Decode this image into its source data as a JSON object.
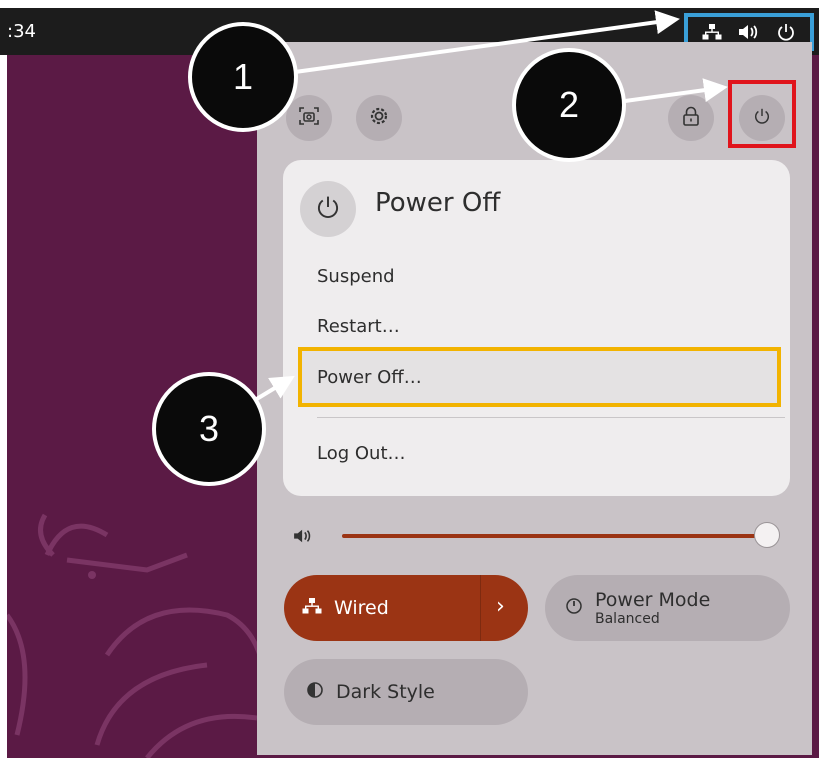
{
  "topbar": {
    "clock": ":34",
    "tray_icons": [
      "network-wired-icon",
      "volume-icon",
      "power-icon"
    ]
  },
  "quick_settings": {
    "top_buttons": [
      "screenshot-icon",
      "settings-icon",
      "lock-icon",
      "power-icon"
    ],
    "power_menu": {
      "title": "Power Off",
      "items": [
        "Suspend",
        "Restart…",
        "Power Off…",
        "Log Out…"
      ]
    },
    "volume": {
      "level": 0.98
    },
    "wired": {
      "label": "Wired",
      "chevron": "›"
    },
    "power_mode": {
      "label": "Power Mode",
      "sublabel": "Balanced"
    },
    "dark_style": {
      "label": "Dark Style"
    }
  },
  "annotations": {
    "callouts": [
      "1",
      "2",
      "3"
    ],
    "colors": {
      "tray_box": "#3a9fd8",
      "power_button_box": "#e0141c",
      "menu_item_box": "#f2b300"
    }
  },
  "colors": {
    "accent": "#9b3414",
    "desktop": "#5b1a45",
    "panel": "#c9c3c7"
  }
}
